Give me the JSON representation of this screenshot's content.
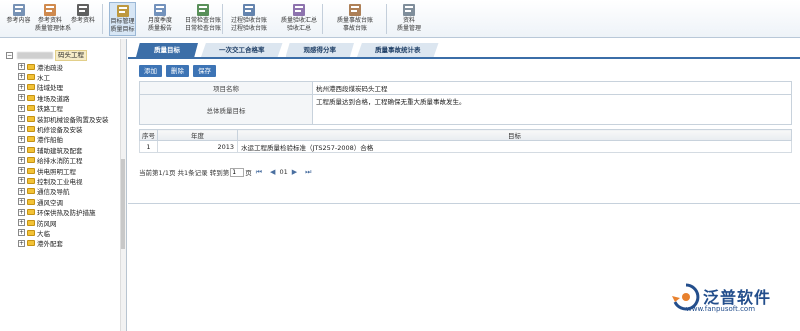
{
  "toolbar": {
    "buttons": [
      {
        "label1": "参考内容",
        "label2": "",
        "icon": "document-icon"
      },
      {
        "label1": "参考资料",
        "label2": "质量管理体系",
        "icon": "people-icon"
      },
      {
        "label1": "参考资料",
        "label2": "",
        "icon": "printer-icon"
      },
      {
        "label1": "目标管理",
        "label2": "质量目标",
        "icon": "target-icon"
      },
      {
        "label1": "月度季度",
        "label2": "质量报告",
        "icon": "report-icon"
      },
      {
        "label1": "日常检查台账",
        "label2": "日常检查台账",
        "icon": "search-icon"
      },
      {
        "label1": "过程验收台账",
        "label2": "过程验收台账",
        "icon": "book-icon"
      },
      {
        "label1": "质量验收汇总",
        "label2": "验收汇总",
        "icon": "chart-icon"
      },
      {
        "label1": "质量事故台账",
        "label2": "事故台账",
        "icon": "clipboard-icon"
      },
      {
        "label1": "资料",
        "label2": "质量管理",
        "icon": "binder-icon"
      }
    ]
  },
  "sidebar": {
    "root_label": "码头工程",
    "items": [
      "港池疏浚",
      "水工",
      "陆域处理",
      "堆场及道路",
      "铁路工程",
      "装卸机械设备购置及安装",
      "机修设备及安装",
      "港作船舶",
      "辅助建筑及配套",
      "给排水消防工程",
      "供电照明工程",
      "控制及工业电视",
      "通信及导航",
      "通风空调",
      "环保供热及防护措施",
      "防风网",
      "大临",
      "港外配套"
    ]
  },
  "tabs": [
    "质量目标",
    "一次交工合格率",
    "观感得分率",
    "质量事故统计表"
  ],
  "actions": [
    "添加",
    "删除",
    "保存"
  ],
  "form": {
    "project_label": "项目名称",
    "project_value": "杭州港西段煤炭码头工程",
    "goal_label": "总体质量目标",
    "goal_value": "工程质量达到合格，工程确保无重大质量事故发生。"
  },
  "grid": {
    "headers": [
      "序号",
      "年度",
      "目标"
    ],
    "rows": [
      {
        "no": "1",
        "year": "2013",
        "goal": "水运工程质量检验标准（JTS257-2008）合格"
      }
    ]
  },
  "pager": {
    "info": "当前第1/1页 共1条记录 转到第",
    "page_input": "1",
    "page_suffix": "页",
    "current": "01"
  },
  "logo": {
    "name": "泛普软件",
    "url": "www.fanpusoft.com"
  }
}
